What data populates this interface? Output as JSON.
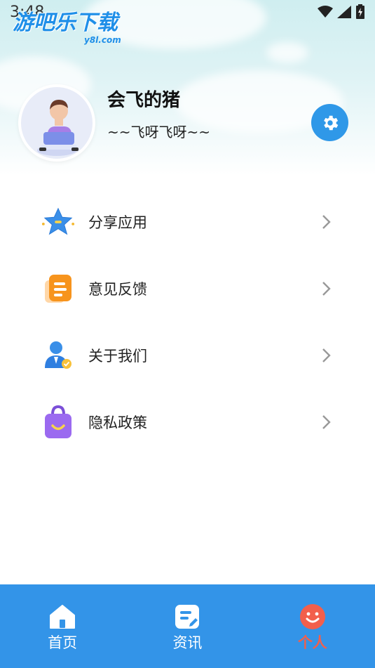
{
  "status_bar": {
    "time": "3:48"
  },
  "watermark": {
    "text": "游吧乐下载",
    "sub": "y8l.com"
  },
  "profile": {
    "name": "会飞的猪",
    "signature": "~~飞呀飞呀~~"
  },
  "menu": {
    "items": [
      {
        "label": "分享应用",
        "icon": "star-icon"
      },
      {
        "label": "意见反馈",
        "icon": "document-icon"
      },
      {
        "label": "关于我们",
        "icon": "user-badge-icon"
      },
      {
        "label": "隐私政策",
        "icon": "bag-icon"
      }
    ]
  },
  "tabbar": {
    "tabs": [
      {
        "label": "首页",
        "icon": "home-icon",
        "active": false
      },
      {
        "label": "资讯",
        "icon": "news-icon",
        "active": false
      },
      {
        "label": "个人",
        "icon": "smile-icon",
        "active": true
      }
    ]
  },
  "colors": {
    "accent": "#3394e8",
    "active_tab": "#f25f4c",
    "settings": "#2f98e8"
  }
}
